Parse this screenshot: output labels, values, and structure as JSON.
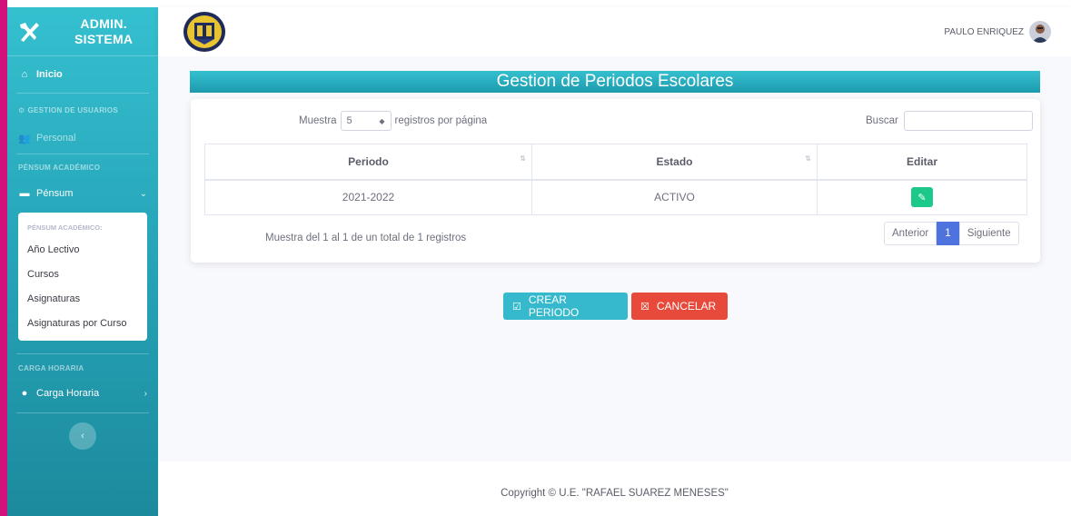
{
  "sidebar": {
    "brand_line1": "ADMIN.",
    "brand_line2": "SISTEMA",
    "inicio": "Inicio",
    "heading_usuarios": "GESTION DE USUARIOS",
    "personal": "Personal",
    "heading_pensum": "PÉNSUM ACADÉMICO",
    "pensum": "Pénsum",
    "collapse_heading": "PÉNSUM ACADÉMICO:",
    "collapse_items": [
      "Año Lectivo",
      "Cursos",
      "Asignaturas",
      "Asignaturas por Curso"
    ],
    "heading_carga": "CARGA HORARIA",
    "carga": "Carga Horaria"
  },
  "topbar": {
    "user_name": "PAULO ENRIQUEZ"
  },
  "main": {
    "title": "Gestion de Periodos Escolares",
    "show_prefix": "Muestra",
    "show_value": "5",
    "show_suffix": "registros por página",
    "search_label": "Buscar",
    "table": {
      "headers": [
        "Periodo",
        "Estado",
        "Editar"
      ],
      "rows": [
        {
          "periodo": "2021-2022",
          "estado": "ACTIVO"
        }
      ]
    },
    "info": "Muestra del 1 al 1 de un total de 1 registros",
    "pager": {
      "prev": "Anterior",
      "current": "1",
      "next": "Siguiente"
    },
    "btn_crear": "CREAR PERIODO",
    "btn_cancelar": "CANCELAR"
  },
  "footer": {
    "text": "Copyright © U.E. \"RAFAEL SUAREZ MENESES\""
  },
  "colors": {
    "sidebar": "#27a6ba",
    "primary": "#4e73df",
    "success": "#1cc88a",
    "info": "#36b9cc",
    "danger": "#e74a3b"
  }
}
